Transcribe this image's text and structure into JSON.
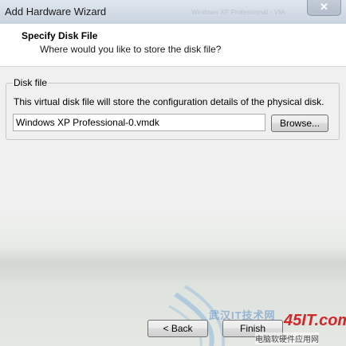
{
  "window": {
    "title": "Add Hardware Wizard",
    "title_extra": "Windows XP Professional - VMware"
  },
  "header": {
    "title": "Specify Disk File",
    "subtitle": "Where would you like to store the disk file?"
  },
  "disk_file": {
    "legend": "Disk file",
    "description": "This virtual disk file will store the configuration details of the physical disk.",
    "path_value": "Windows XP Professional-0.vmdk",
    "browse_label": "Browse..."
  },
  "footer": {
    "back_label": "< Back",
    "finish_label": "Finish"
  },
  "watermark": {
    "text": "武汉IT技术网",
    "logo": "45IT.com",
    "subtitle": "电脑软硬件应用网"
  },
  "icons": {
    "close": "close-icon"
  }
}
